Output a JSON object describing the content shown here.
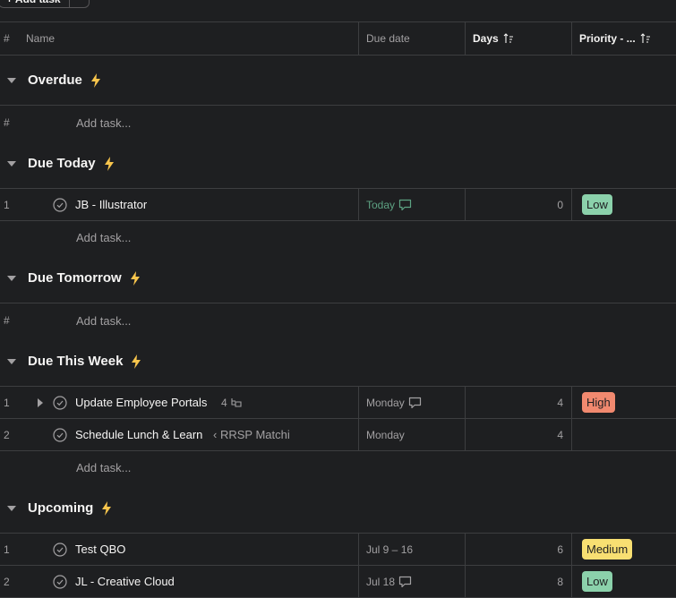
{
  "toolbar": {
    "add_task_label": "+ Add task"
  },
  "columns": {
    "num": "#",
    "name": "Name",
    "due": "Due date",
    "days": "Days",
    "priority": "Priority - ..."
  },
  "add_task_placeholder": "Add task...",
  "sections": {
    "overdue": {
      "title": "Overdue"
    },
    "due_today": {
      "title": "Due Today",
      "tasks": [
        {
          "index": "1",
          "name": "JB - Illustrator",
          "due": "Today",
          "days": "0",
          "priority": "Low"
        }
      ]
    },
    "due_tomorrow": {
      "title": "Due Tomorrow"
    },
    "due_this_week": {
      "title": "Due This Week",
      "tasks": [
        {
          "index": "1",
          "name": "Update Employee Portals",
          "subtasks": "4",
          "due": "Monday",
          "days": "4",
          "priority": "High"
        },
        {
          "index": "2",
          "name": "Schedule Lunch & Learn",
          "parent": "‹ RRSP Matchi",
          "due": "Monday",
          "days": "4",
          "priority": ""
        }
      ]
    },
    "upcoming": {
      "title": "Upcoming",
      "tasks": [
        {
          "index": "1",
          "name": "Test QBO",
          "due": "Jul 9 – 16",
          "days": "6",
          "priority": "Medium"
        },
        {
          "index": "2",
          "name": "JL - Creative Cloud",
          "due": "Jul 18",
          "days": "8",
          "priority": "Low"
        }
      ]
    }
  },
  "colors": {
    "low": "#8bd1ab",
    "high": "#f1896f",
    "medium": "#f8df72",
    "bolt": "#f8c54c",
    "today": "#5da283"
  }
}
